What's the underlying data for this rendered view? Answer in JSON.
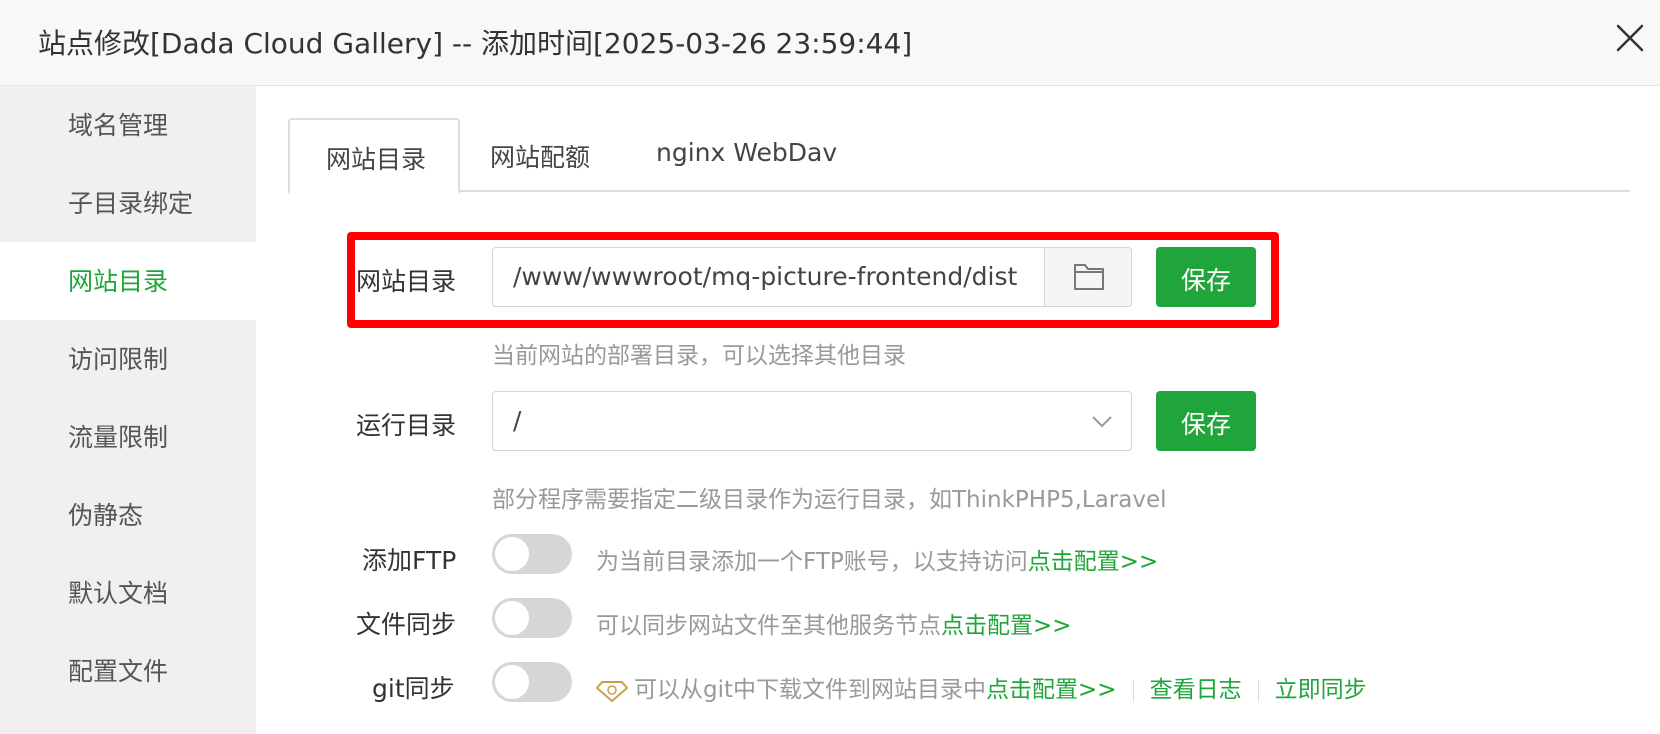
{
  "dialog": {
    "title": "站点修改[Dada Cloud Gallery] -- 添加时间[2025-03-26 23:59:44]"
  },
  "sidebar": {
    "items": [
      {
        "label": "域名管理"
      },
      {
        "label": "子目录绑定"
      },
      {
        "label": "网站目录"
      },
      {
        "label": "访问限制"
      },
      {
        "label": "流量限制"
      },
      {
        "label": "伪静态"
      },
      {
        "label": "默认文档"
      },
      {
        "label": "配置文件"
      }
    ],
    "active": "网站目录"
  },
  "tabs": [
    {
      "label": "网站目录"
    },
    {
      "label": "网站配额"
    },
    {
      "label": "nginx WebDav"
    }
  ],
  "site_dir": {
    "label": "网站目录",
    "value": "/www/wwwroot/mq-picture-frontend/dist",
    "save_label": "保存",
    "hint": "当前网站的部署目录，可以选择其他目录"
  },
  "run_dir": {
    "label": "运行目录",
    "value": "/",
    "save_label": "保存",
    "hint": "部分程序需要指定二级目录作为运行目录，如ThinkPHP5,Laravel"
  },
  "ftp": {
    "label": "添加FTP",
    "desc": "为当前目录添加一个FTP账号，以支持访问",
    "link": "点击配置>>",
    "enabled": false
  },
  "sync": {
    "label": "文件同步",
    "desc": "可以同步网站文件至其他服务节点",
    "link": "点击配置>>",
    "enabled": false
  },
  "git": {
    "label": "git同步",
    "desc": "可以从git中下载文件到网站目录中",
    "link": "点击配置>>",
    "log_link": "查看日志",
    "sync_link": "立即同步",
    "enabled": false
  },
  "colors": {
    "accent": "#20a53a",
    "highlight": "#ff0000"
  },
  "icons": {
    "close": "close-icon",
    "folder": "folder-icon",
    "chevron": "chevron-down-icon",
    "vip": "vip-diamond-icon"
  }
}
